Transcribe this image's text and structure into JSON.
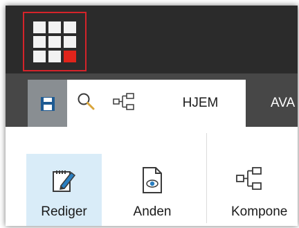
{
  "quick_access": {
    "save_icon": "save-icon",
    "search_icon": "search-icon",
    "tree_icon": "tree-structure-icon"
  },
  "tabs": [
    {
      "label": "HJEM",
      "active": true
    },
    {
      "label": "AVA",
      "active": false
    }
  ],
  "ribbon": {
    "buttons": [
      {
        "label": "Rediger",
        "icon": "edit-document-icon",
        "selected": true
      },
      {
        "label": "Anden",
        "icon": "document-view-icon",
        "selected": false
      },
      {
        "label": "Kompone",
        "icon": "component-tree-icon",
        "selected": false
      }
    ]
  },
  "colors": {
    "topbar": "#2b2b2b",
    "tabstrip": "#474747",
    "accent_red": "#e0241b",
    "selected_bg": "#d9ecf8"
  }
}
